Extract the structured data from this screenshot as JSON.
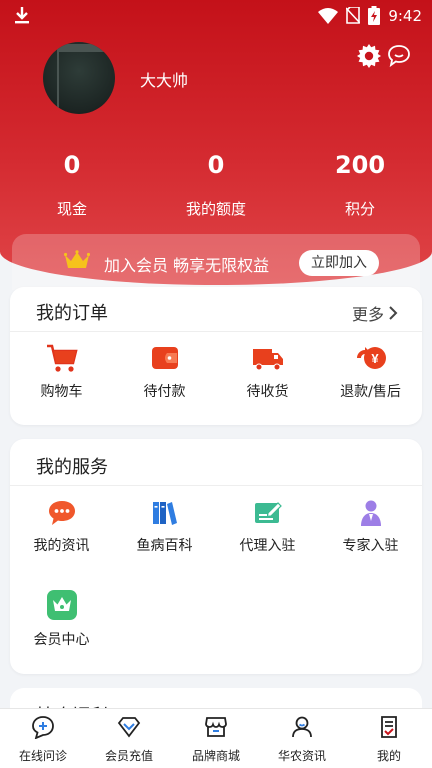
{
  "status_bar": {
    "time": "9:42",
    "icons": [
      "download-icon",
      "wifi-icon",
      "no-sim-icon",
      "battery-charging-icon"
    ]
  },
  "profile": {
    "username": "大大帅",
    "header_icons": [
      "gear-icon",
      "chat-bubble-icon"
    ]
  },
  "stats": [
    {
      "value": "0",
      "label": "现金"
    },
    {
      "value": "0",
      "label": "我的额度"
    },
    {
      "value": "200",
      "label": "积分"
    }
  ],
  "membership": {
    "text": "加入会员 畅享无限权益",
    "button": "立即加入",
    "icon": "crown-icon"
  },
  "orders": {
    "title": "我的订单",
    "more": "更多",
    "items": [
      {
        "label": "购物车",
        "icon": "shopping-cart-icon"
      },
      {
        "label": "待付款",
        "icon": "wallet-icon"
      },
      {
        "label": "待收货",
        "icon": "delivery-truck-icon"
      },
      {
        "label": "退款/售后",
        "icon": "refund-icon"
      }
    ]
  },
  "services": {
    "title": "我的服务",
    "items": [
      {
        "label": "我的资讯",
        "icon": "message-icon"
      },
      {
        "label": "鱼病百科",
        "icon": "books-icon"
      },
      {
        "label": "代理入驻",
        "icon": "agent-card-icon"
      },
      {
        "label": "专家入驻",
        "icon": "expert-icon"
      },
      {
        "label": "会员中心",
        "icon": "member-crown-icon"
      }
    ]
  },
  "next_section": {
    "title": "扶农福利"
  },
  "tabbar": [
    {
      "label": "在线问诊",
      "icon": "consult-icon"
    },
    {
      "label": "会员充值",
      "icon": "recharge-icon"
    },
    {
      "label": "品牌商城",
      "icon": "store-icon"
    },
    {
      "label": "华农资讯",
      "icon": "news-person-icon"
    },
    {
      "label": "我的",
      "icon": "profile-doc-icon"
    }
  ],
  "colors": {
    "primary_red": "#c8141c",
    "icon_orange": "#f0572b",
    "icon_blue": "#2f7de1",
    "icon_green": "#3cba92",
    "icon_purple": "#9d7ee6"
  }
}
